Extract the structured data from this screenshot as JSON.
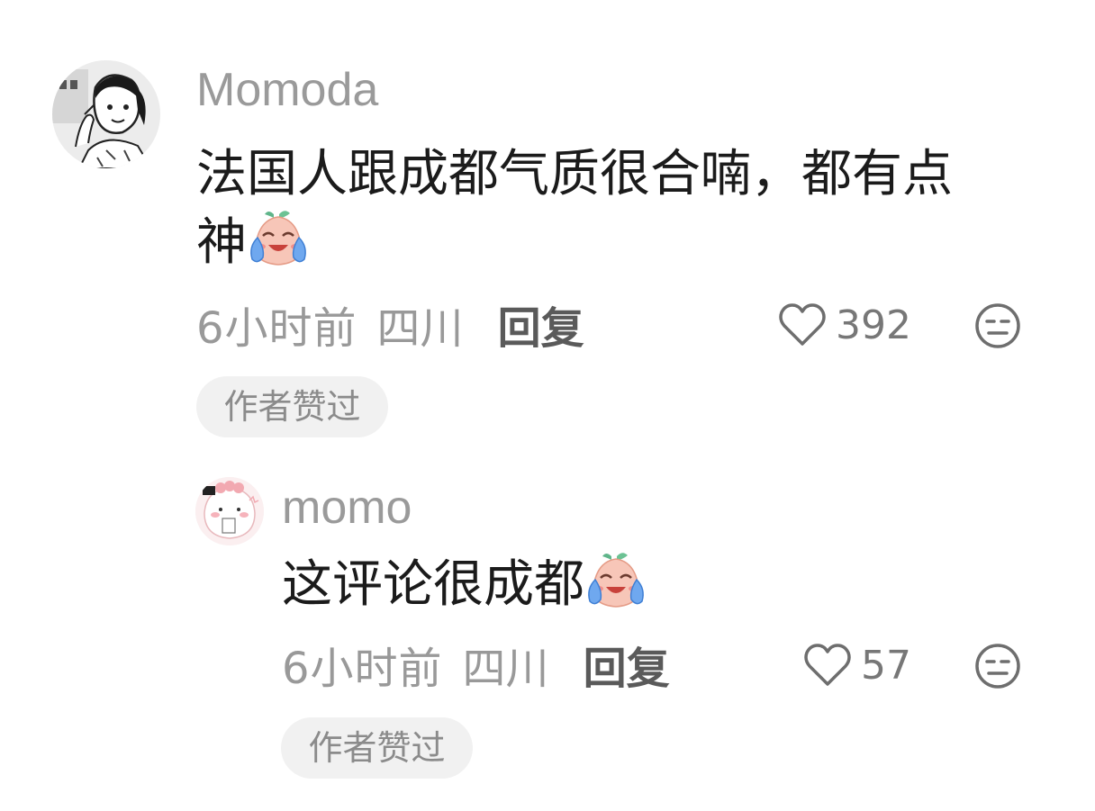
{
  "comments": [
    {
      "username": "Momoda",
      "text_line1": "法国人跟成都气质很合喃，都有点",
      "text_line2": "神",
      "emoji_icon": "laughing-crying-emoji-icon",
      "time": "6小时前",
      "region": "四川",
      "reply_label": "回复",
      "like_count": "392",
      "badge": "作者赞过"
    },
    {
      "username": "momo",
      "text": "这评论很成都",
      "emoji_icon": "laughing-crying-emoji-icon",
      "time": "6小时前",
      "region": "四川",
      "reply_label": "回复",
      "like_count": "57",
      "badge": "作者赞过"
    }
  ],
  "icons": {
    "like": "heart-outline-icon",
    "dislike": "meh-face-icon"
  },
  "colors": {
    "username": "#9a9a9a",
    "text": "#1b1b1b",
    "meta": "#999999",
    "reply": "#5a5a5a",
    "badge_bg": "#f1f1f1",
    "badge_text": "#8b8b8b"
  }
}
